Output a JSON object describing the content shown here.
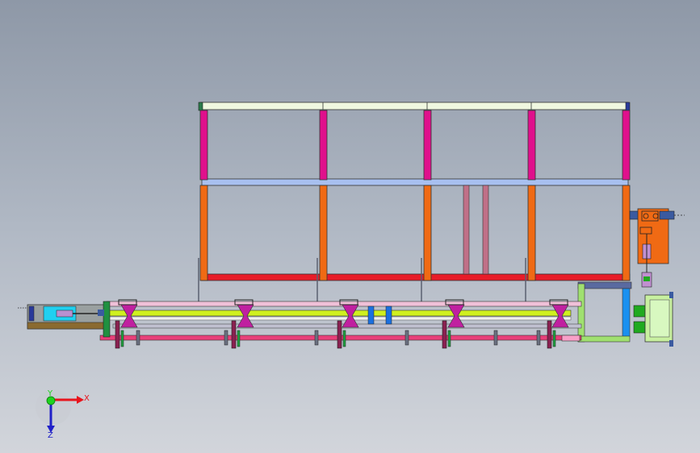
{
  "viewport": {
    "background_top": "#8e98a7",
    "background_bottom": "#d2d5db"
  },
  "triad": {
    "x_label": "X",
    "y_label": "Y",
    "z_label": "Z",
    "x_color": "#e8141c",
    "y_color": "#1fd21f",
    "z_color": "#2020c8"
  },
  "model": {
    "frame_top_color": "#f0f8e0",
    "post_upper_color": "#e0108c",
    "post_lower_color": "#f06a14",
    "mid_rail_color": "#a8c0f0",
    "bottom_rail_color": "#e81c28",
    "conveyor_color": "#d0f020",
    "motor_box_color": "#f06a14",
    "right_box_color": "#a0e070"
  }
}
